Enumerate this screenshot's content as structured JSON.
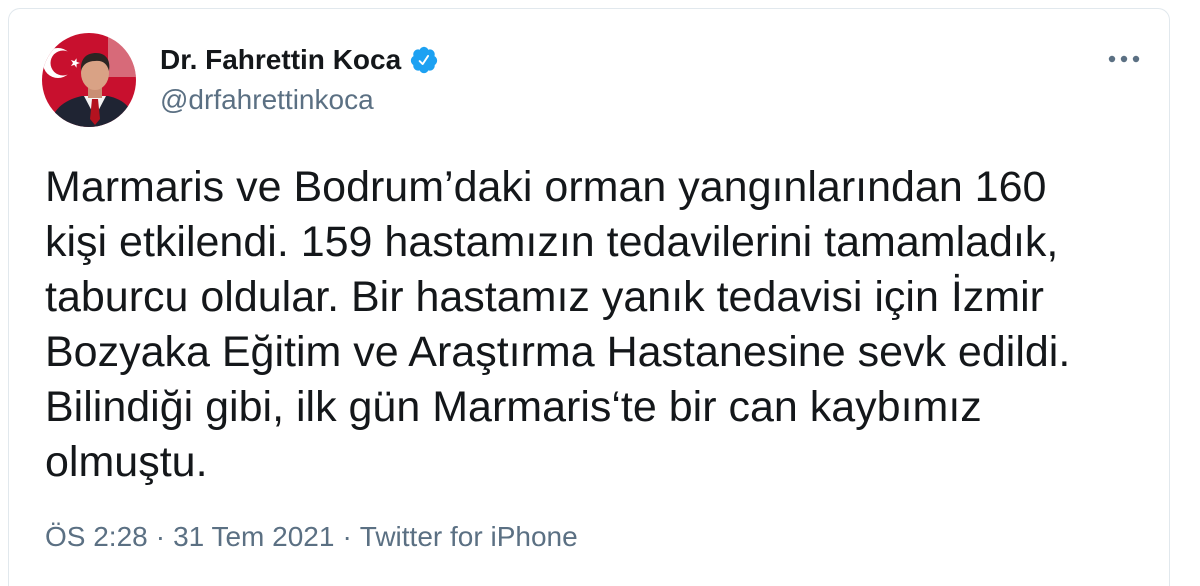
{
  "tweet": {
    "author": {
      "name": "Dr. Fahrettin Koca",
      "handle": "@drfahrettinkoca",
      "verified": true
    },
    "text_lines": [
      "Marmaris ve Bodrum’daki orman yangınlarından 160",
      "kişi etkilendi. 159 hastamızın tedavilerini tamamladık,",
      "taburcu oldular. Bir hastamız yanık tedavisi için İzmir",
      "Bozyaka Eğitim ve Araştırma Hastanesine sevk edildi.",
      "Bilindiği gibi, ilk gün Marmaris‘te bir can kaybımız",
      "olmuştu."
    ],
    "meta": {
      "time": "ÖS 2:28",
      "separator": "·",
      "date": "31 Tem 2021",
      "source": "Twitter for iPhone"
    }
  },
  "icons": {
    "verified": "verified-badge-icon",
    "more": "more-options-icon"
  },
  "colors": {
    "primary": "#14171a",
    "secondary": "#5b7083",
    "verified": "#1da1f2",
    "border": "#e1e8ed",
    "avatar-bg": "#c8102e"
  }
}
